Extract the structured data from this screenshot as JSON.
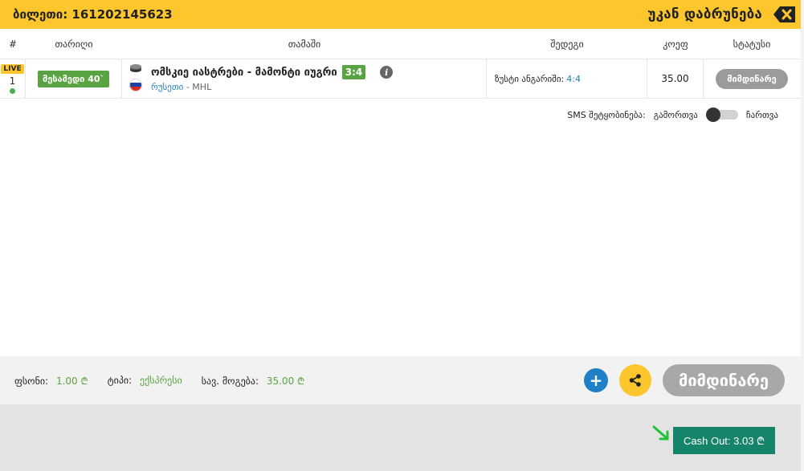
{
  "header": {
    "ticket_label": "ბილეთი: 161202145623",
    "back_label": "უკან დაბრუნება"
  },
  "table": {
    "columns": [
      "#",
      "თარიღი",
      "თამაში",
      "შედეგი",
      "კოეფ",
      "სტატუსი"
    ],
    "rows": [
      {
        "live_badge": "LIVE",
        "number": "1",
        "period": "მესამედი 40`",
        "game": "ომსკიე იასტრები - მამონტი იუგრი",
        "score": "3:4",
        "country": "რუსეთი",
        "league": "- MHL",
        "result_label": "ზუსტი ანგარიში:",
        "result_value": "4:4",
        "odd": "35.00",
        "status": "მიმდინარე"
      }
    ]
  },
  "sms": {
    "label": "SMS შეტყობინება:",
    "off_label": "გამორთვა",
    "on_label": "ჩართვა",
    "enabled": false
  },
  "footer": {
    "stake_label": "ფსონი:",
    "stake_value": "1.00 ₾",
    "type_label": "ტიპი:",
    "type_value": "ექსპრესი",
    "potential_label": "სავ. მოგება:",
    "potential_value": "35.00 ₾",
    "plus_label": "+",
    "status_button": "მიმდინარე"
  },
  "cashout": {
    "label": "Cash Out: 3.03 ₾"
  },
  "colors": {
    "accent_yellow": "#fcc62c",
    "green": "#5aa342",
    "cashout_green": "#16836b",
    "blue": "#1f7fc7",
    "grey_status": "#9b9b9b"
  },
  "icons": {
    "back": "close-x-icon",
    "sport": "hockey-puck-icon",
    "flag": "russia-flag-icon",
    "info": "info-icon",
    "share": "share-icon",
    "arrow": "green-arrow-icon"
  }
}
